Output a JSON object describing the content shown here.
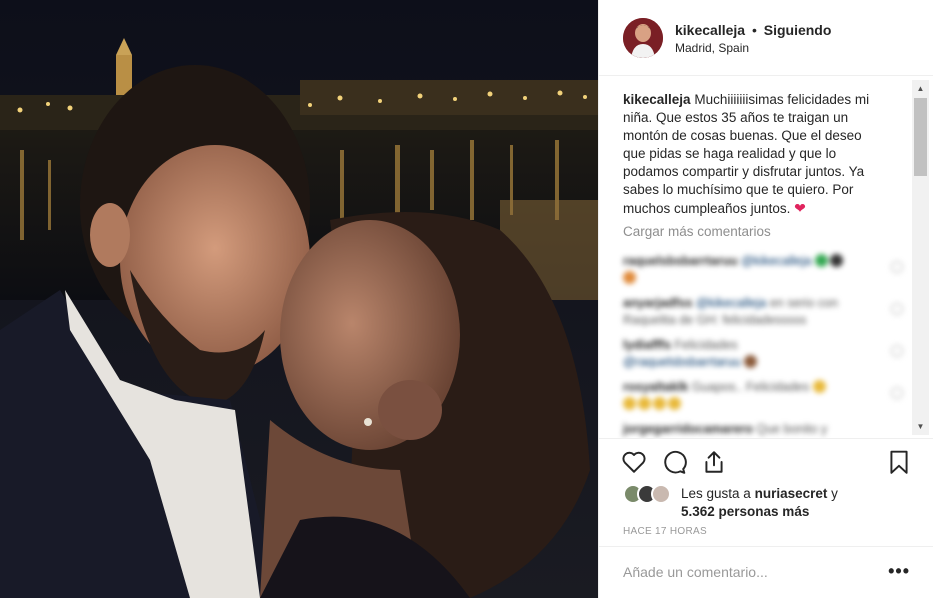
{
  "post": {
    "photo_alt": "",
    "header": {
      "username": "kikecalleja",
      "separator": "•",
      "follow_status": "Siguiendo",
      "location": "Madrid, Spain"
    },
    "caption": {
      "username": "kikecalleja",
      "text": "Muchiiiiiiisimas felicidades mi niña. Que estos 35 años te traigan un montón de cosas buenas. Que el deseo que pidas se haga realidad y que lo podamos compartir y disfrutar juntos. Ya sabes lo muchísimo que te quiero. Por muchos cumpleaños juntos.",
      "emoji": "❤"
    },
    "load_more_label": "Cargar más comentarios",
    "blurred_comments": [
      {
        "user": "raquelsbsbarrtaruu",
        "mention": "@kikecalleja",
        "text": ""
      },
      {
        "user": "anyarjadfss",
        "mention": "@kikecalleja",
        "text": "en serio con Raquelita de GH: felicidadesssss"
      },
      {
        "user": "lydiafffs",
        "mention": "@raquelsbsbarrtaruu",
        "text": "Felicidades"
      },
      {
        "user": "rosyaltaklk",
        "mention": "",
        "text": "Guapos.. Felicidades"
      },
      {
        "user": "jorgegarridocamarero",
        "mention": "",
        "text": "Que bonito y"
      }
    ],
    "actions": {
      "like_icon": "heart-icon",
      "comment_icon": "comment-icon",
      "share_icon": "share-icon",
      "save_icon": "bookmark-icon"
    },
    "likes": {
      "prefix": "Les gusta a",
      "user": "nuriasecret",
      "conj": "y",
      "count": "5.362 personas más"
    },
    "timestamp": "HACE 17 HORAS",
    "add_comment_placeholder": "Añade un comentario...",
    "more_options": "•••"
  },
  "colors": {
    "border": "#efefef",
    "text": "#262626",
    "muted": "#8e8e8e",
    "heart": "#e0245e"
  }
}
